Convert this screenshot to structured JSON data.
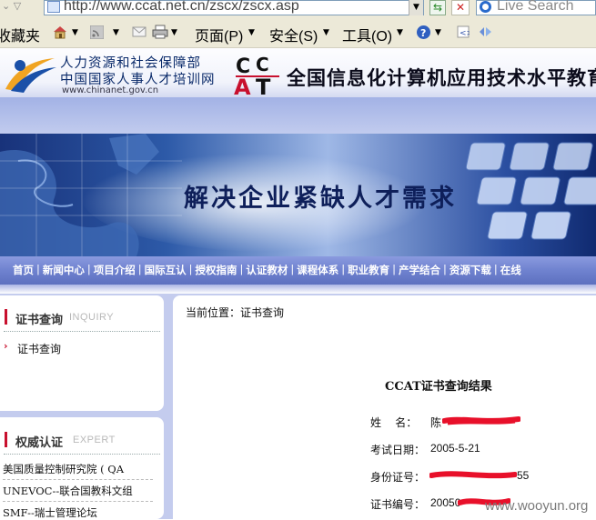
{
  "browser": {
    "url": "http://www.ccat.net.cn/zscx/zscx.asp",
    "search_placeholder": "Live Search",
    "toolbar": {
      "favorites_label": "收藏夹",
      "page_menu": "页面(P)",
      "safety_menu": "安全(S)",
      "tools_menu": "工具(O)"
    }
  },
  "header": {
    "ministry_name_line1": "人力资源和社会保障部",
    "ministry_name_line2": "中国国家人事人才培训网",
    "ministry_site": "www.chinanet.gov.cn",
    "ccat_title": "全国信息化计算机应用技术水平教育",
    "ccat_logo_text": "CCAT",
    "banner_slogan": "解决企业紧缺人才需求"
  },
  "nav": {
    "items": [
      "首页",
      "新闻中心",
      "项目介绍",
      "国际互认",
      "授权指南",
      "认证教材",
      "课程体系",
      "职业教育",
      "产学结合",
      "资源下载",
      "在线"
    ]
  },
  "sidebar": {
    "panel1": {
      "title": "证书查询",
      "subtitle": "INQUIRY",
      "link": "证书查询"
    },
    "panel2": {
      "title": "权威认证",
      "subtitle": "EXPERT",
      "items": [
        "美国质量控制研究院 ( QA",
        "UNEVOC--联合国教科文组",
        "SMF--瑞士管理论坛"
      ]
    }
  },
  "main": {
    "breadcrumb": "当前位置：证书查询",
    "result_title": "CCAT证书查询结果",
    "fields": [
      {
        "label": "姓    名：",
        "value": "陈"
      },
      {
        "label": "考试日期：",
        "value": "2005-5-21"
      },
      {
        "label": "身份证号：",
        "value": "55"
      },
      {
        "label": "证书编号：",
        "value": "20050"
      }
    ]
  },
  "watermark": "www.wooyun.org",
  "colors": {
    "nav_bar": "#6f82cf",
    "sidebar_bg": "#c4ccee",
    "accent_red": "#c8102e",
    "redaction": "#e8102a"
  }
}
